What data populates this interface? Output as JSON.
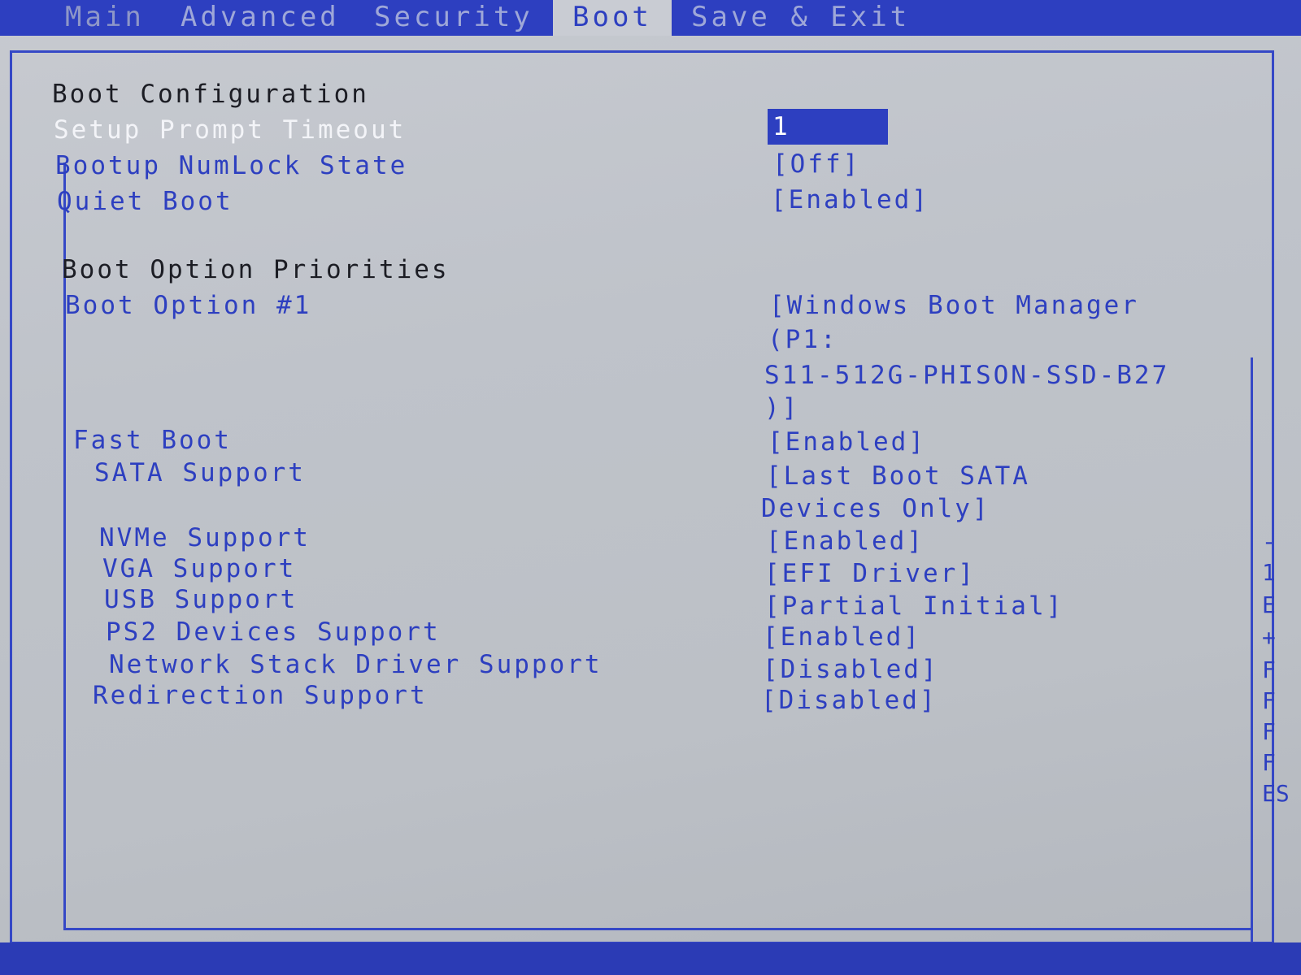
{
  "menu": {
    "tabs": [
      "Main",
      "Advanced",
      "Security",
      "Boot",
      "Save & Exit"
    ],
    "active_tab": "Boot"
  },
  "boot_configuration": {
    "title": "Boot Configuration",
    "setup_prompt_timeout": {
      "label": "Setup Prompt Timeout",
      "value": "1"
    },
    "bootup_numlock_state": {
      "label": "Bootup NumLock State",
      "value": "[Off]"
    },
    "quiet_boot": {
      "label": "Quiet Boot",
      "value": "[Enabled]"
    }
  },
  "boot_option_priorities": {
    "title": "Boot Option Priorities",
    "boot_option_1": {
      "label": "Boot Option #1",
      "value_lines": [
        "[Windows Boot Manager",
        "(P1:",
        "S11-512G-PHISON-SSD-B27",
        ")]"
      ]
    }
  },
  "fast_boot": {
    "label": "Fast Boot",
    "value": "[Enabled]",
    "sata_support": {
      "label": "SATA Support",
      "value_lines": [
        "[Last Boot SATA",
        "Devices Only]"
      ]
    },
    "nvme_support": {
      "label": "NVMe Support",
      "value": "[Enabled]"
    },
    "vga_support": {
      "label": "VGA Support",
      "value": "[EFI Driver]"
    },
    "usb_support": {
      "label": "USB Support",
      "value": "[Partial Initial]"
    },
    "ps2_devices_support": {
      "label": "PS2 Devices Support",
      "value": "[Enabled]"
    },
    "network_stack_driver_support": {
      "label": "Network Stack Driver Support",
      "value": "[Disabled]"
    }
  },
  "redirection_support": {
    "label": "Redirection Support",
    "value": "[Disabled]"
  },
  "help_column": [
    "-",
    "1",
    "E",
    "+",
    "F",
    "F",
    "F",
    "F",
    "ES"
  ],
  "colors": {
    "accent_blue": "#2d3fc0",
    "background_gray": "#c2c5cb",
    "selected_text": "#f3f4f8",
    "section_text": "#1c1d24"
  }
}
